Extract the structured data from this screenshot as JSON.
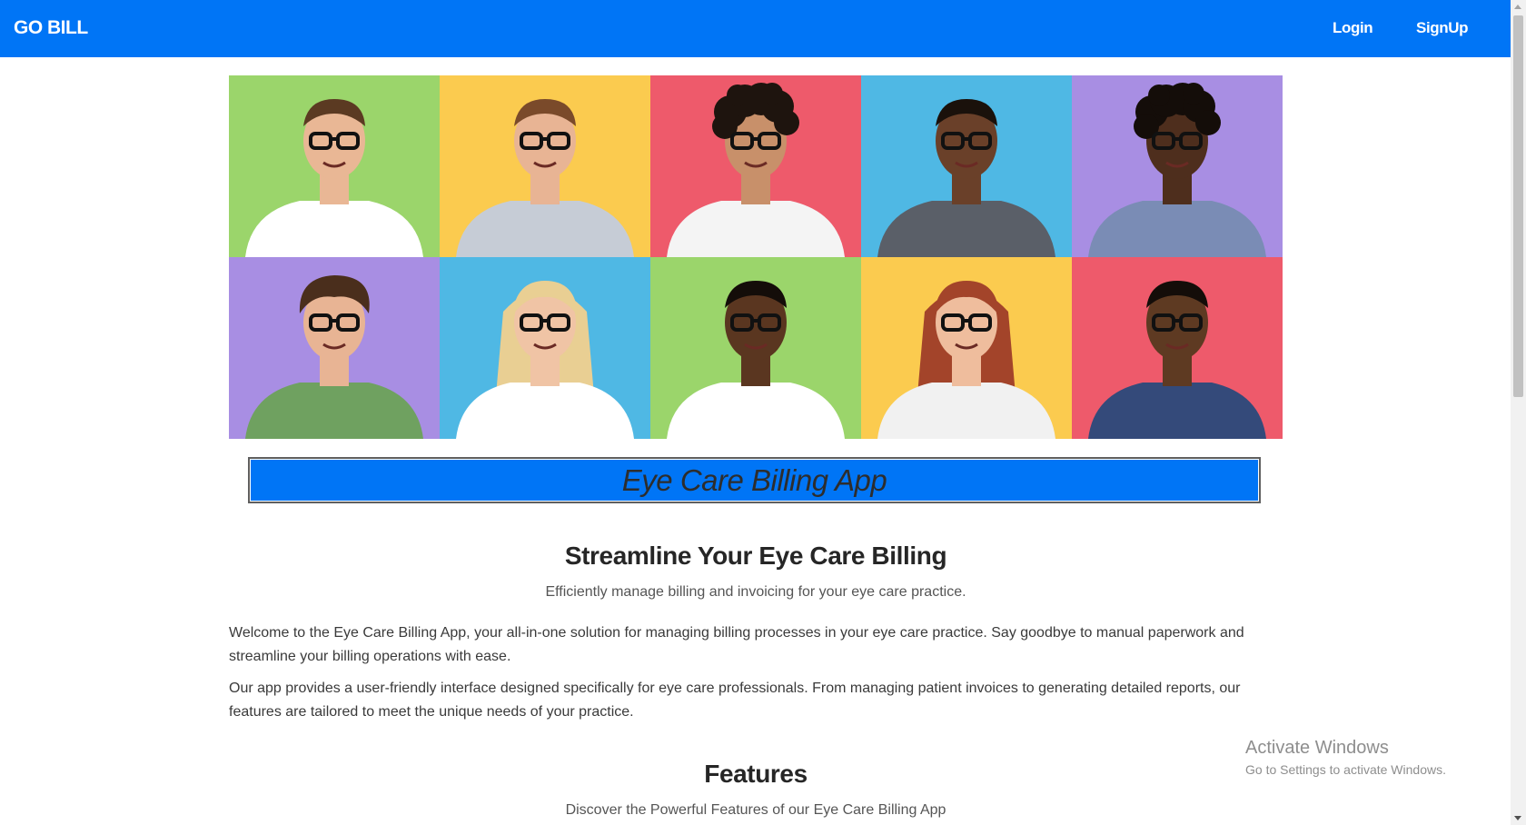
{
  "navbar": {
    "brand": "GO BILL",
    "login_label": "Login",
    "signup_label": "SignUp",
    "bg_color": "#0075f6"
  },
  "hero": {
    "tiles": [
      {
        "bg": "#9bd56b",
        "skin": "#e9b795",
        "hair": "#5b3a22",
        "shirt": "#ffffff",
        "hair_style": "short"
      },
      {
        "bg": "#fbcb4f",
        "skin": "#e8b494",
        "hair": "#7a4a2a",
        "shirt": "#c6ccd6",
        "hair_style": "short"
      },
      {
        "bg": "#ee5a6b",
        "skin": "#c8906a",
        "hair": "#1e140e",
        "shirt": "#f4f4f4",
        "hair_style": "curly"
      },
      {
        "bg": "#4fb8e4",
        "skin": "#6a4029",
        "hair": "#1a110b",
        "shirt": "#5a5f68",
        "hair_style": "short"
      },
      {
        "bg": "#a88ee3",
        "skin": "#4e2e1d",
        "hair": "#140d09",
        "shirt": "#7a8cb5",
        "hair_style": "curly"
      },
      {
        "bg": "#a88ee3",
        "skin": "#e8b494",
        "hair": "#4a2e1c",
        "shirt": "#6fa160",
        "hair_style": "messy"
      },
      {
        "bg": "#4fb8e4",
        "skin": "#f0c4a5",
        "hair": "#e9cf93",
        "shirt": "#ffffff",
        "hair_style": "long"
      },
      {
        "bg": "#9bd56b",
        "skin": "#5a3620",
        "hair": "#140d09",
        "shirt": "#ffffff",
        "hair_style": "short"
      },
      {
        "bg": "#fbcb4f",
        "skin": "#efbd9d",
        "hair": "#a3442a",
        "shirt": "#f1f1f1",
        "hair_style": "long"
      },
      {
        "bg": "#ee5a6b",
        "skin": "#5e3a22",
        "hair": "#140d09",
        "shirt": "#344a7a",
        "hair_style": "short"
      }
    ]
  },
  "title_bar": {
    "text": "Eye Care Billing App"
  },
  "intro": {
    "heading": "Streamline Your Eye Care Billing",
    "subheading": "Efficiently manage billing and invoicing for your eye care practice.",
    "paragraph_1": "Welcome to the Eye Care Billing App, your all-in-one solution for managing billing processes in your eye care practice. Say goodbye to manual paperwork and streamline your billing operations with ease.",
    "paragraph_2": "Our app provides a user-friendly interface designed specifically for eye care professionals. From managing patient invoices to generating detailed reports, our features are tailored to meet the unique needs of your practice."
  },
  "features": {
    "heading": "Features",
    "subheading": "Discover the Powerful Features of our Eye Care Billing App"
  },
  "watermark": {
    "title": "Activate Windows",
    "subtitle": "Go to Settings to activate Windows."
  }
}
